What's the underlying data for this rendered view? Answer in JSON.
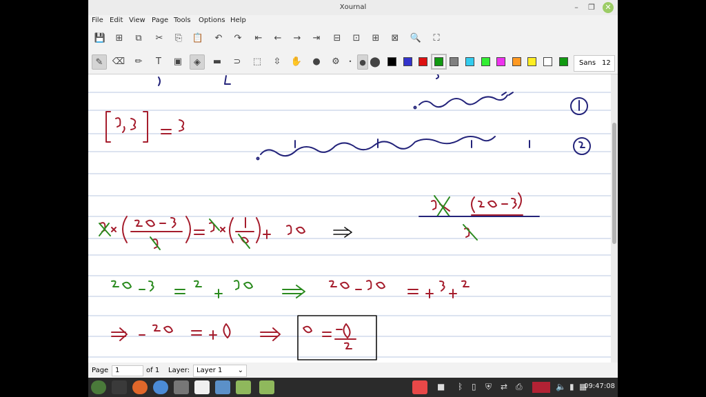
{
  "window": {
    "title": "Xournal"
  },
  "menu": [
    "File",
    "Edit",
    "View",
    "Page",
    "Tools",
    "Options",
    "Help"
  ],
  "toolbar_main": [
    {
      "name": "save-icon",
      "glyph": "💾"
    },
    {
      "name": "new-page-icon",
      "glyph": "⊞"
    },
    {
      "name": "copy-page-icon",
      "glyph": "⧉"
    },
    {
      "name": "cut-icon",
      "glyph": "✂"
    },
    {
      "name": "copy-icon",
      "glyph": "⎘"
    },
    {
      "name": "paste-icon",
      "glyph": "📋"
    },
    {
      "name": "undo-icon",
      "glyph": "↶"
    },
    {
      "name": "redo-icon",
      "glyph": "↷"
    },
    {
      "name": "first-page-icon",
      "glyph": "⇤"
    },
    {
      "name": "prev-page-icon",
      "glyph": "←"
    },
    {
      "name": "next-page-icon",
      "glyph": "→"
    },
    {
      "name": "last-page-icon",
      "glyph": "⇥"
    },
    {
      "name": "zoom-out-icon",
      "glyph": "⊟"
    },
    {
      "name": "zoom-fit-icon",
      "glyph": "⊡"
    },
    {
      "name": "zoom-in-icon",
      "glyph": "⊞"
    },
    {
      "name": "zoom-page-icon",
      "glyph": "⊠"
    },
    {
      "name": "find-icon",
      "glyph": "🔍"
    },
    {
      "name": "fullscreen-icon",
      "glyph": "⛶"
    }
  ],
  "toolbar_tools": [
    {
      "name": "pen-icon",
      "glyph": "✎",
      "active": true
    },
    {
      "name": "eraser-icon",
      "glyph": "⌫",
      "active": false
    },
    {
      "name": "highlighter-icon",
      "glyph": "✏",
      "active": false
    },
    {
      "name": "text-icon",
      "glyph": "T",
      "active": false
    },
    {
      "name": "image-icon",
      "glyph": "▣",
      "active": false
    },
    {
      "name": "shape-recognizer-icon",
      "glyph": "◈",
      "active": true
    },
    {
      "name": "ruler-icon",
      "glyph": "▬",
      "active": false
    },
    {
      "name": "lasso-icon",
      "glyph": "⊃",
      "active": false
    },
    {
      "name": "rect-select-icon",
      "glyph": "⬚",
      "active": false
    },
    {
      "name": "vertical-space-icon",
      "glyph": "⇳",
      "active": false
    },
    {
      "name": "hand-icon",
      "glyph": "✋",
      "active": false
    },
    {
      "name": "default-pen-icon",
      "glyph": "●",
      "active": false
    },
    {
      "name": "pen-options-icon",
      "glyph": "⚙",
      "active": false
    }
  ],
  "thickness": [
    {
      "name": "thin-dot-icon",
      "glyph": "•",
      "active": false
    },
    {
      "name": "medium-dot-icon",
      "glyph": "●",
      "active": true
    },
    {
      "name": "thick-dot-icon",
      "glyph": "⬤",
      "active": false
    }
  ],
  "colors": [
    "#000000",
    "#3333cc",
    "#dd1111",
    "#119911",
    "#808080",
    "#33ccee",
    "#33ee33",
    "#ee33ee",
    "#ff9922",
    "#ffee22",
    "#ffffff",
    "#119911"
  ],
  "selected_color_index": 3,
  "font": {
    "name": "Sans",
    "size": "12"
  },
  "status": {
    "page_label": "Page",
    "page_value": "1",
    "of_label": "of 1",
    "layer_label": "Layer:",
    "layer_value": "Layer 1"
  },
  "clock": "09:47:08"
}
